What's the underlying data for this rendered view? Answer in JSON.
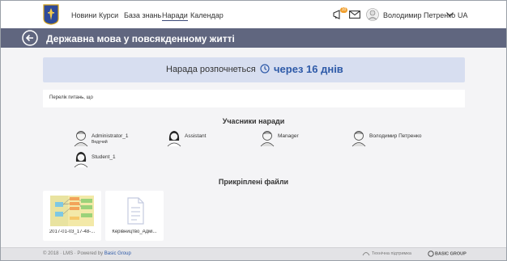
{
  "nav": {
    "items": [
      "Новини",
      "Курси",
      "База знань",
      "Наради",
      "Календар"
    ],
    "active_index": 3
  },
  "user": {
    "name": "Володимир Петренко",
    "language": "UA",
    "notification_count": "10"
  },
  "page": {
    "title": "Державна мова у повсякденному житті"
  },
  "countdown": {
    "label": "Нарада розпочнеться",
    "value": "через 16 днів"
  },
  "agenda": {
    "text": "Перелік питань, що"
  },
  "participants": {
    "title": "Учасники наради",
    "items": [
      {
        "name": "Administrator_1",
        "role": "Ведучий",
        "gender": "male"
      },
      {
        "name": "Assistant",
        "role": "",
        "gender": "female"
      },
      {
        "name": "Manager",
        "role": "",
        "gender": "male"
      },
      {
        "name": "Володимир Петренко",
        "role": "",
        "gender": "male"
      },
      {
        "name": "Student_1",
        "role": "",
        "gender": "female"
      }
    ]
  },
  "files": {
    "title": "Прикріплені файли",
    "items": [
      {
        "name": "2017-01-03_17-48-...",
        "type": "image"
      },
      {
        "name": "Керівництво_Адмі...",
        "type": "document"
      }
    ]
  },
  "footer": {
    "copyright": "© 2018 · LMS · Powered by",
    "powered_by": "Basic Group",
    "support": "Технічна підтримка",
    "brand": "BASIC GROUP"
  },
  "colors": {
    "header": "#60667f",
    "accent": "#2e5aa8",
    "countdown_bg": "#d7def0"
  }
}
